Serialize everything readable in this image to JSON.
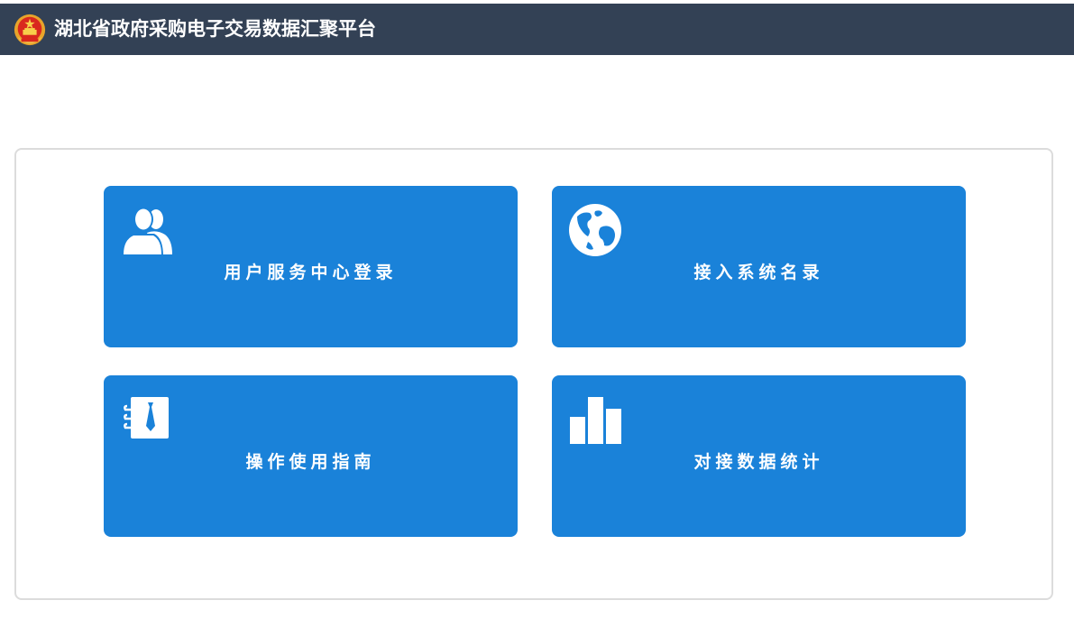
{
  "header": {
    "title": "湖北省政府采购电子交易数据汇聚平台",
    "logo_icon": "national-emblem-icon",
    "background_color": "#334155"
  },
  "tiles": [
    {
      "label": "用户服务中心登录",
      "icon": "users-icon"
    },
    {
      "label": "接入系统名录",
      "icon": "globe-icon"
    },
    {
      "label": "操作使用指南",
      "icon": "guide-book-icon"
    },
    {
      "label": "对接数据统计",
      "icon": "bar-chart-icon"
    }
  ],
  "colors": {
    "tile_background": "#1a82d9",
    "tile_text": "#ffffff",
    "panel_border": "#dcdcdc"
  }
}
